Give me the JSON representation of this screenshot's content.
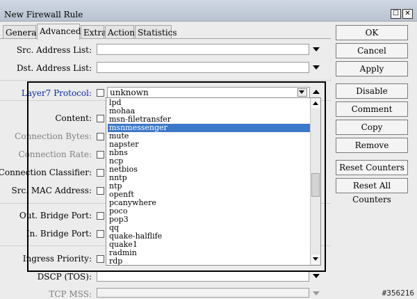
{
  "window": {
    "title": "New Firewall Rule"
  },
  "tabs": [
    {
      "label": "General"
    },
    {
      "label": "Advanced"
    },
    {
      "label": "Extra"
    },
    {
      "label": "Action"
    },
    {
      "label": "Statistics"
    }
  ],
  "active_tab": "Advanced",
  "fields": {
    "src_address_list": "Src. Address List:",
    "dst_address_list": "Dst. Address List:",
    "layer7_protocol": "Layer7 Protocol:",
    "layer7_value": "unknown",
    "content": "Content:",
    "connection_bytes": "Connection Bytes:",
    "connection_rate": "Connection Rate:",
    "per_connection_classifier": "Per Connection Classifier:",
    "src_mac_address": "Src. MAC Address:",
    "out_bridge_port": "Out. Bridge Port:",
    "in_bridge_port": "In. Bridge Port:",
    "ingress_priority": "Ingress Priority:",
    "dscp_tos": "DSCP (TOS):",
    "tcp_mss": "TCP MSS:"
  },
  "dropdown": {
    "items": [
      "lpd",
      "mohaa",
      "msn-filetransfer",
      "msnmessenger",
      "mute",
      "napster",
      "nbns",
      "ncp",
      "netbios",
      "nntp",
      "ntp",
      "openft",
      "pcanywhere",
      "poco",
      "pop3",
      "qq",
      "quake-halflife",
      "quake1",
      "radmin",
      "rdp"
    ],
    "selected": "msnmessenger"
  },
  "buttons": {
    "ok": "OK",
    "cancel": "Cancel",
    "apply": "Apply",
    "disable": "Disable",
    "comment": "Comment",
    "copy": "Copy",
    "remove": "Remove",
    "reset_counters": "Reset Counters",
    "reset_all_counters": "Reset All Counters"
  },
  "watermark": "#356216",
  "colors": {
    "selected_bg": "#3b78c9",
    "label_blue": "#0a2ba5"
  }
}
